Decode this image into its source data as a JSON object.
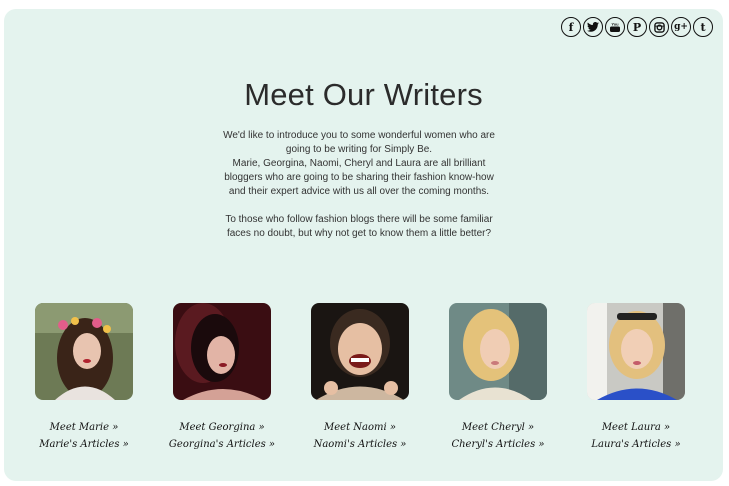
{
  "social": [
    {
      "name": "facebook-icon",
      "glyph": "f"
    },
    {
      "name": "twitter-icon",
      "glyph": ""
    },
    {
      "name": "youtube-icon",
      "glyph": ""
    },
    {
      "name": "pinterest-icon",
      "glyph": "P"
    },
    {
      "name": "instagram-icon",
      "glyph": ""
    },
    {
      "name": "google-plus-icon",
      "glyph": "g+"
    },
    {
      "name": "tumblr-icon",
      "glyph": "t"
    }
  ],
  "page": {
    "title": "Meet Our Writers",
    "intro_lines": [
      "We'd like to introduce you to some wonderful women who are",
      "going to be writing for Simply Be.",
      "Marie, Georgina, Naomi, Cheryl and Laura are all brilliant",
      "bloggers who are going to be sharing their fashion know-how",
      "and their expert advice with us all over the coming months."
    ],
    "intro_lines_2": [
      "To those who follow fashion blogs there will be some familiar",
      "faces no doubt, but why not get to know them a little better?"
    ]
  },
  "writers": [
    {
      "name": "Marie",
      "meet": "Meet Marie »",
      "articles": "Marie's Articles »"
    },
    {
      "name": "Georgina",
      "meet": "Meet Georgina »",
      "articles": "Georgina's Articles »"
    },
    {
      "name": "Naomi",
      "meet": "Meet Naomi »",
      "articles": "Naomi's Articles »"
    },
    {
      "name": "Cheryl",
      "meet": "Meet Cheryl »",
      "articles": "Cheryl's Articles »"
    },
    {
      "name": "Laura",
      "meet": "Meet Laura »",
      "articles": "Laura's Articles »"
    }
  ],
  "colors": {
    "panel_bg": "#e4f3ee",
    "text": "#2b2b2b"
  }
}
